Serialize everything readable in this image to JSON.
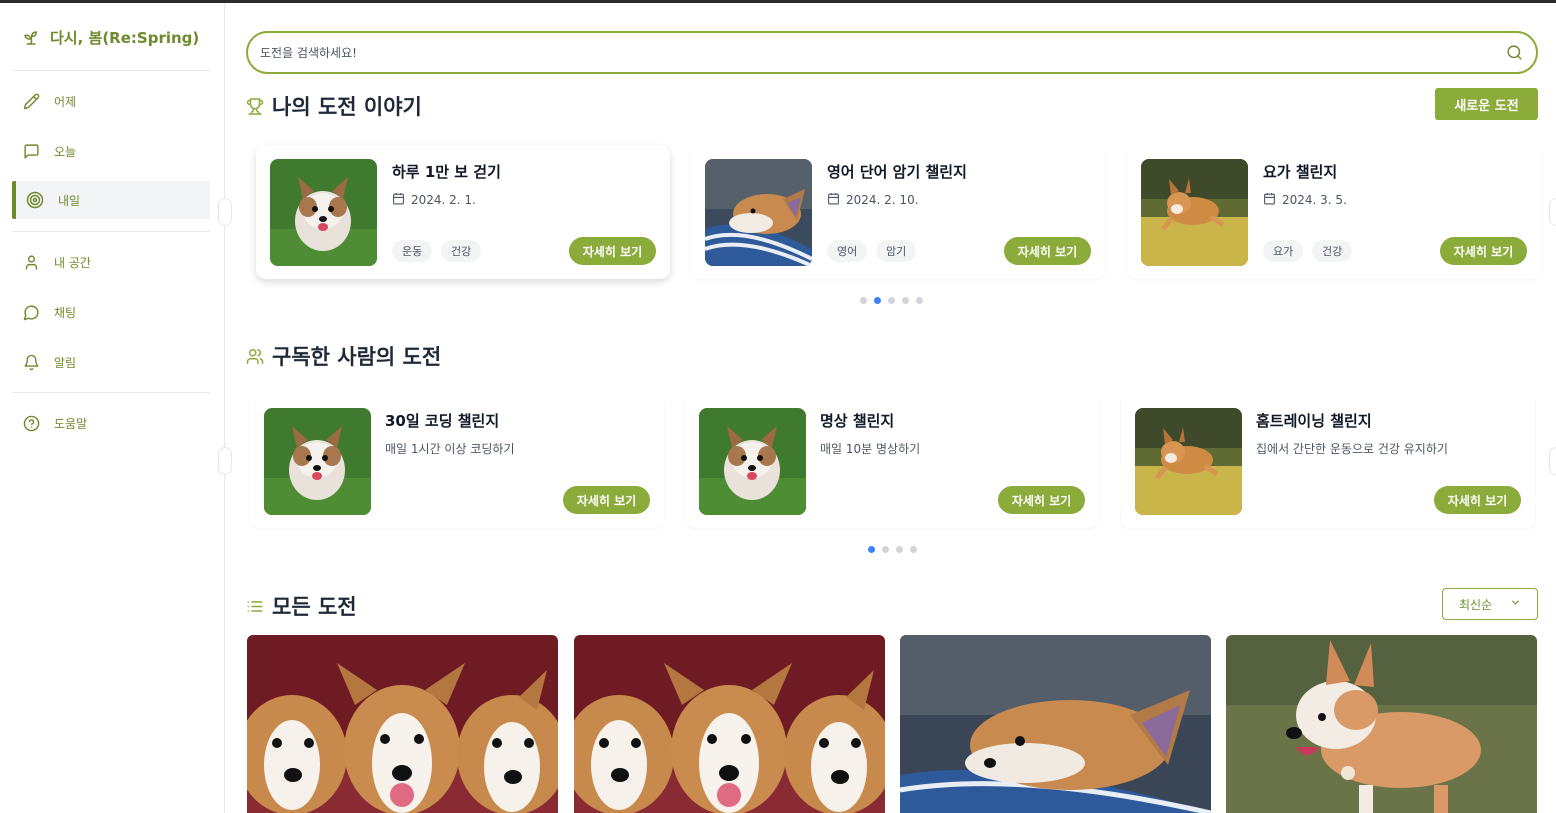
{
  "app": {
    "brand": "다시, 봄(Re:Spring)",
    "icon": "sprout-icon",
    "accent": "#8bab3a",
    "brand_color": "#6f8a2d"
  },
  "sidebar": {
    "items": [
      {
        "label": "어제",
        "icon": "pencil-icon"
      },
      {
        "label": "오늘",
        "icon": "message-square-icon"
      },
      {
        "label": "내일",
        "icon": "target-icon",
        "active": true
      },
      {
        "label": "내 공간",
        "icon": "user-icon"
      },
      {
        "label": "채팅",
        "icon": "chat-bubble-icon"
      },
      {
        "label": "알림",
        "icon": "bell-icon"
      },
      {
        "label": "도움말",
        "icon": "help-circle-icon"
      }
    ]
  },
  "search": {
    "placeholder": "도전을 검색하세요!",
    "value": ""
  },
  "my_challenges": {
    "title": "나의 도전 이야기",
    "new_button": "새로운 도전",
    "cards": [
      {
        "title": "하루 1만 보 걷기",
        "date": "2024. 2. 1.",
        "tags": [
          "운동",
          "건강"
        ],
        "button": "자세히 보기",
        "image": "corgi-puppy-grass"
      },
      {
        "title": "영어 단어 암기 챌린지",
        "date": "2024. 2. 10.",
        "tags": [
          "영어",
          "암기"
        ],
        "button": "자세히 보기",
        "image": "corgi-closeup"
      },
      {
        "title": "요가 챌린지",
        "date": "2024. 3. 5.",
        "tags": [
          "요가",
          "건강"
        ],
        "button": "자세히 보기",
        "image": "corgi-running-field"
      }
    ],
    "pages": 5,
    "active_page": 2
  },
  "subscribed": {
    "title": "구독한 사람의 도전",
    "cards": [
      {
        "title": "30일 코딩 챌린지",
        "desc": "매일 1시간 이상 코딩하기",
        "button": "자세히 보기",
        "image": "corgi-puppy-grass"
      },
      {
        "title": "명상 챌린지",
        "desc": "매일 10분 명상하기",
        "button": "자세히 보기",
        "image": "corgi-puppy-grass"
      },
      {
        "title": "홈트레이닝 챌린지",
        "desc": "집에서 간단한 운동으로 건강 유지하기",
        "button": "자세히 보기",
        "image": "corgi-running-field"
      }
    ],
    "pages": 4,
    "active_page": 1
  },
  "all": {
    "title": "모든 도전",
    "sort": {
      "selected": "최신순"
    },
    "images": [
      "three-corgis",
      "three-corgis",
      "corgi-closeup",
      "corgi-walking-grass"
    ]
  }
}
